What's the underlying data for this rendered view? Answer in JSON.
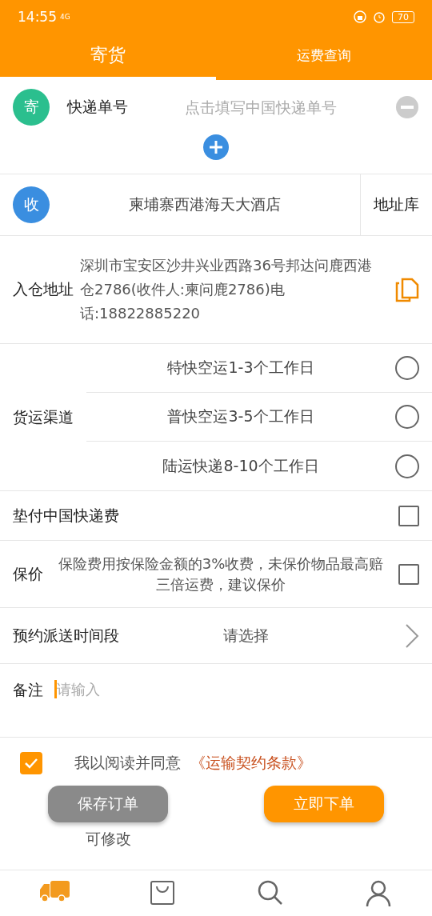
{
  "status_bar": {
    "time": "14:55",
    "network": "4G",
    "battery": "70"
  },
  "tabs": [
    {
      "label": "寄货",
      "selected": true
    },
    {
      "label": "运费查询",
      "selected": false
    }
  ],
  "express": {
    "badge": "寄",
    "label": "快递单号",
    "placeholder": "点击填写中国快递单号"
  },
  "receiver": {
    "badge": "收",
    "name": "柬埔寨西港海天大酒店",
    "button": "地址库"
  },
  "warehouse": {
    "label": "入仓地址",
    "address": "深圳市宝安区沙井兴业西路36号邦达问鹿西港仓2786(收件人:柬问鹿2786)电话:18822885220"
  },
  "channels": {
    "label": "货运渠道",
    "options": [
      {
        "label": "特快空运1-3个工作日",
        "selected": false
      },
      {
        "label": "普快空运3-5个工作日",
        "selected": false
      },
      {
        "label": "陆运快递8-10个工作日",
        "selected": false
      }
    ]
  },
  "advance": {
    "label": "垫付中国快递费",
    "checked": false
  },
  "insurance": {
    "label": "保价",
    "note": "保险费用按保险金额的3%收费，未保价物品最高赔三倍运费，建议保价",
    "checked": false
  },
  "schedule": {
    "label": "预约派送时间段",
    "value": "请选择"
  },
  "remark": {
    "label": "备注",
    "placeholder": "请输入"
  },
  "agreement": {
    "checked": true,
    "text": "我以阅读并同意",
    "link": "《运输契约条款》"
  },
  "actions": {
    "save": "保存订单",
    "save_note": "可修改",
    "submit": "立即下单"
  },
  "nav": [
    {
      "kind": "truck",
      "selected": true
    },
    {
      "kind": "bag",
      "selected": false
    },
    {
      "kind": "search",
      "selected": false
    },
    {
      "kind": "user",
      "selected": false
    }
  ]
}
